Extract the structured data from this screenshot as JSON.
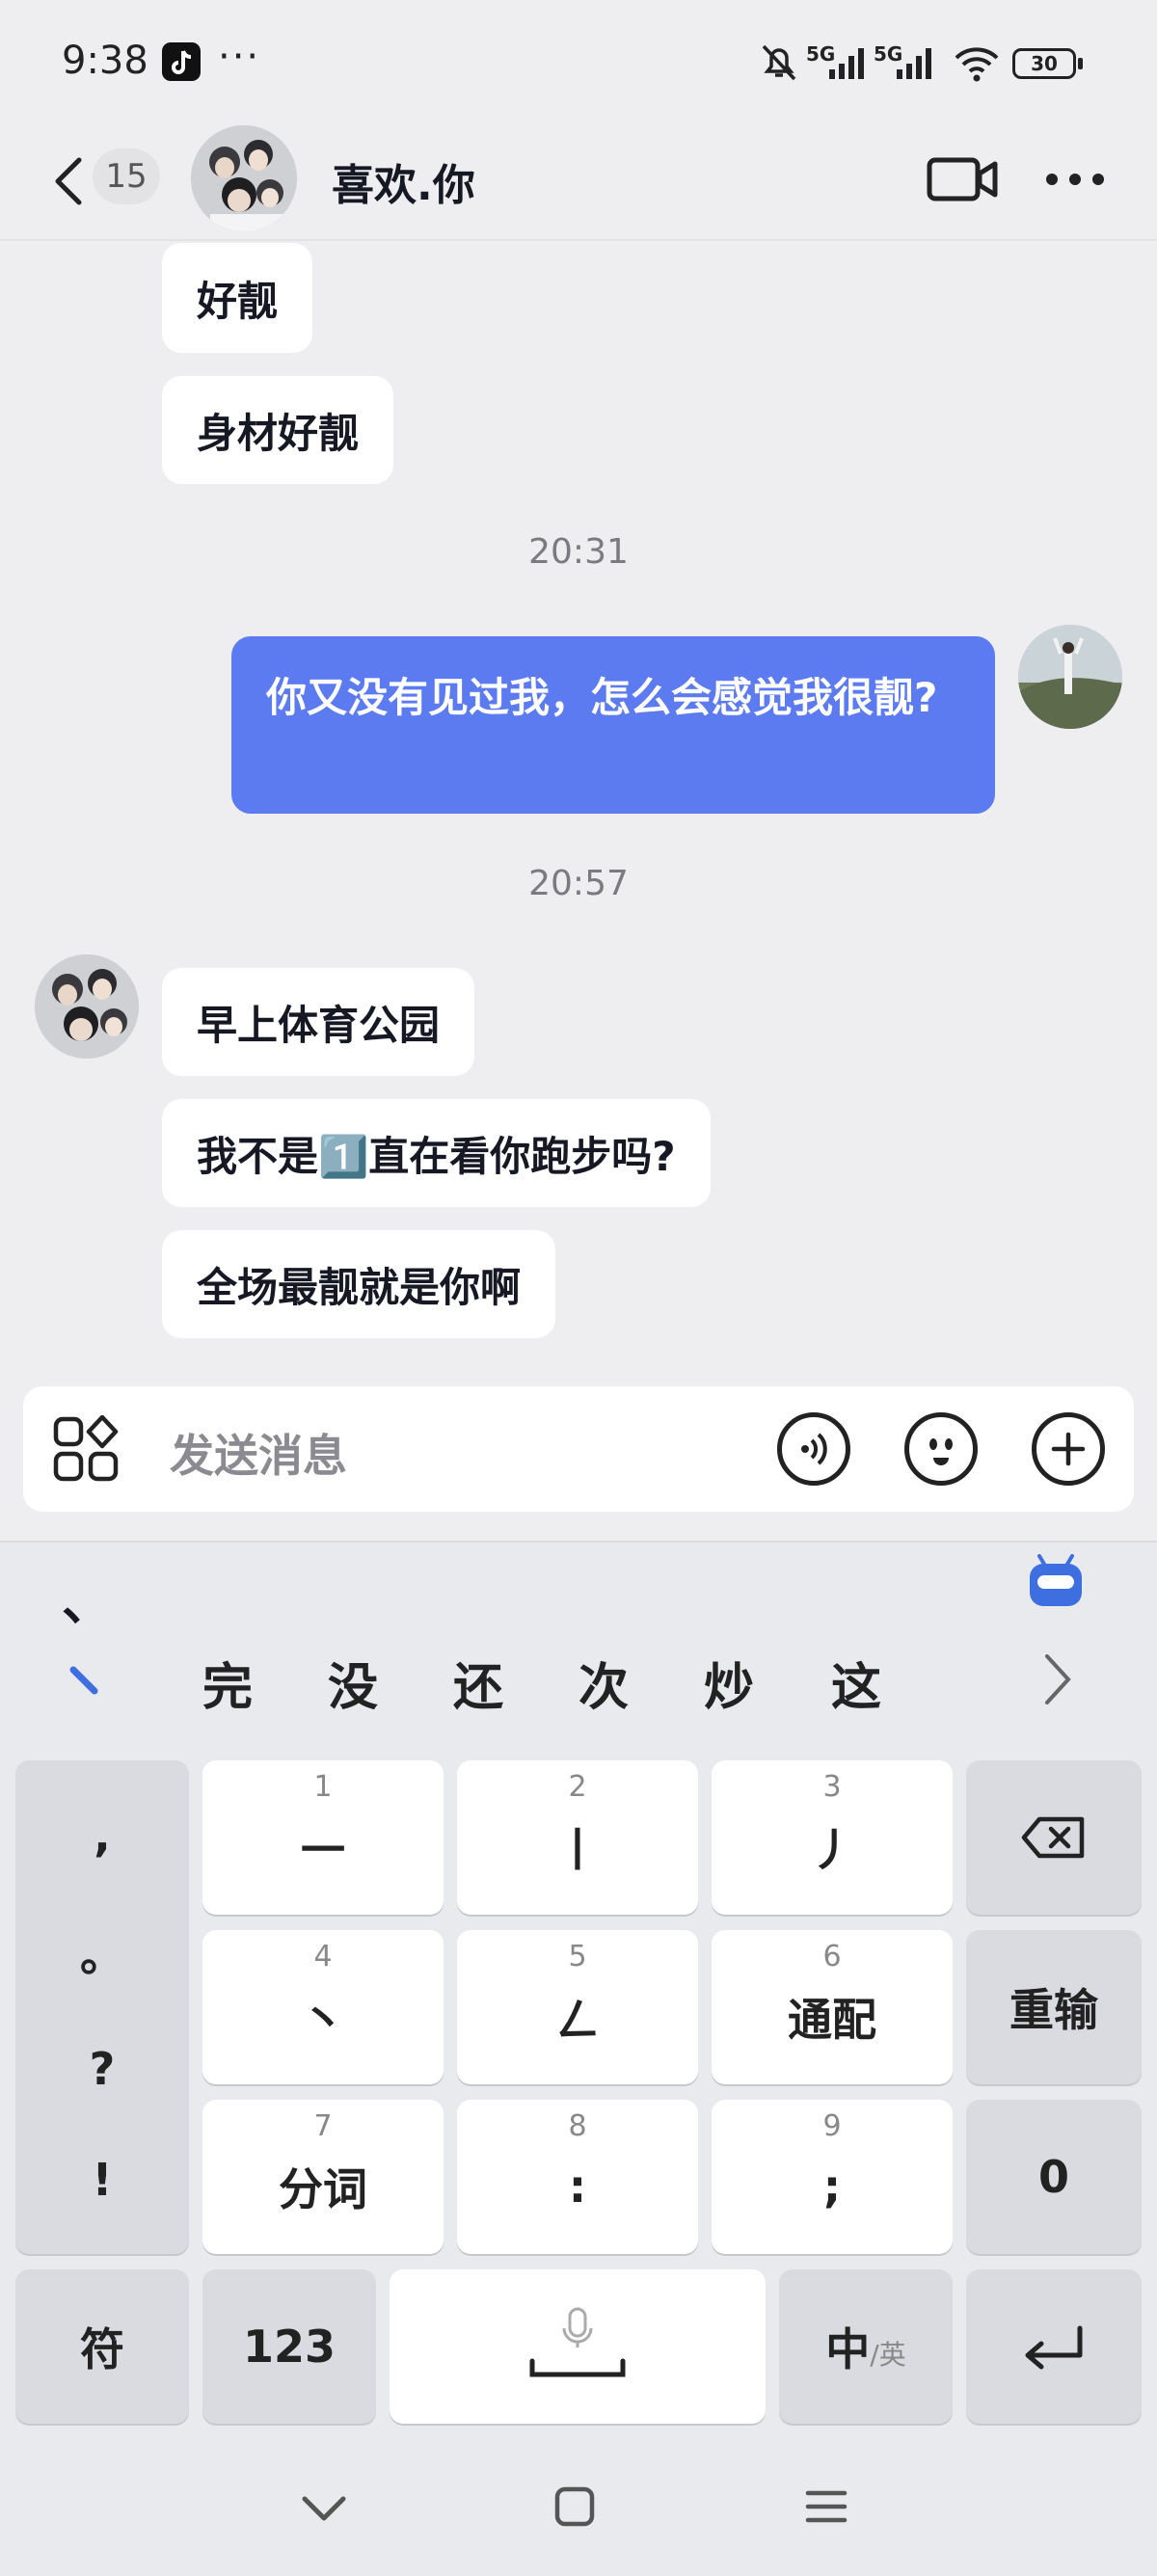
{
  "status_bar": {
    "time": "9:38",
    "more": "···",
    "net1": "5G",
    "net2": "5G",
    "battery": "30"
  },
  "header": {
    "unread_count": "15",
    "contact_name": "喜欢.你"
  },
  "messages": [
    {
      "side": "left",
      "text": "好靓"
    },
    {
      "side": "left",
      "text": "身材好靓"
    },
    {
      "type": "time",
      "text": "20:31"
    },
    {
      "side": "right",
      "text": "你又没有见过我，怎么会感觉我很靓?"
    },
    {
      "type": "time",
      "text": "20:57"
    },
    {
      "side": "left",
      "text": "早上体育公园"
    },
    {
      "side": "left",
      "text": "我不是1️⃣直在看你跑步吗?"
    },
    {
      "side": "left",
      "text": "全场最靓就是你啊"
    }
  ],
  "input": {
    "placeholder": "发送消息"
  },
  "keyboard": {
    "composing": "、",
    "candidates": [
      "完",
      "没",
      "还",
      "次",
      "炒",
      "这"
    ],
    "left_column": [
      ",",
      "。",
      "?",
      "!"
    ],
    "keys": [
      {
        "num": "1",
        "label": "一"
      },
      {
        "num": "2",
        "label": "丨"
      },
      {
        "num": "3",
        "label": "丿"
      },
      {
        "num": "4",
        "label": "丶"
      },
      {
        "num": "5",
        "label": "ㄥ"
      },
      {
        "num": "6",
        "label": "通配"
      },
      {
        "num": "7",
        "label": "分词"
      },
      {
        "num": "8",
        "label": ":"
      },
      {
        "num": "9",
        "label": ";"
      }
    ],
    "reinput": "重输",
    "zero": "0",
    "symbols": "符",
    "numbers": "123",
    "lang_main": "中",
    "lang_alt": "/英"
  },
  "colors": {
    "accent_bubble": "#5c7bf0",
    "background": "#eeeef0"
  }
}
